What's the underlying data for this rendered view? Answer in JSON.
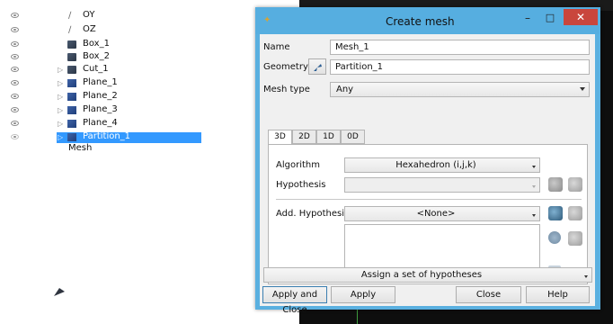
{
  "tree": {
    "items": [
      {
        "label": "OY",
        "icon": "axis-icon",
        "expandable": false
      },
      {
        "label": "OZ",
        "icon": "axis-icon",
        "expandable": false
      },
      {
        "label": "Box_1",
        "icon": "box-icon",
        "expandable": false
      },
      {
        "label": "Box_2",
        "icon": "box-icon",
        "expandable": false
      },
      {
        "label": "Cut_1",
        "icon": "box-icon",
        "expandable": true
      },
      {
        "label": "Plane_1",
        "icon": "plane-icon",
        "expandable": true
      },
      {
        "label": "Plane_2",
        "icon": "plane-icon",
        "expandable": true
      },
      {
        "label": "Plane_3",
        "icon": "plane-icon",
        "expandable": true
      },
      {
        "label": "Plane_4",
        "icon": "plane-icon",
        "expandable": true
      },
      {
        "label": "Partition_1",
        "icon": "partition-icon",
        "expandable": true,
        "selected": true
      }
    ],
    "mesh_label": "Mesh"
  },
  "dialog": {
    "title": "Create mesh",
    "name_label": "Name",
    "name_value": "Mesh_1",
    "geometry_label": "Geometry",
    "geometry_value": "Partition_1",
    "mesh_type_label": "Mesh type",
    "mesh_type_value": "Any",
    "tabs": [
      "3D",
      "2D",
      "1D",
      "0D"
    ],
    "active_tab": "3D",
    "algorithm_label": "Algorithm",
    "algorithm_value": "Hexahedron (i,j,k)",
    "hypothesis_label": "Hypothesis",
    "hypothesis_value": "",
    "add_hypothesis_label": "Add. Hypothesis",
    "add_hypothesis_value": "<None>",
    "assign_set_label": "Assign a set of hypotheses",
    "buttons": {
      "apply_close": "Apply and Close",
      "apply": "Apply",
      "close": "Close",
      "help": "Help"
    }
  },
  "colors": {
    "titlebar": "#56aee0",
    "selection": "#3399ff",
    "close_button": "#c9463d"
  }
}
